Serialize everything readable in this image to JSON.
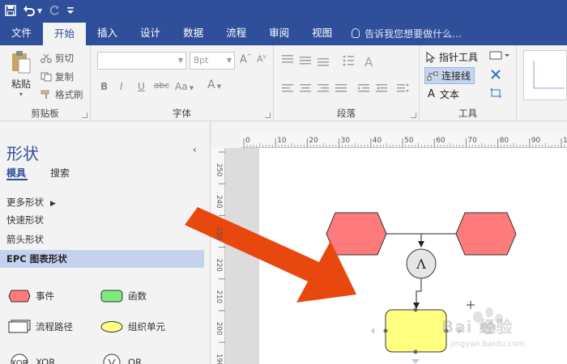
{
  "quick_access": {
    "save_icon": "save-icon",
    "undo_icon": "undo-icon",
    "redo_icon": "redo-icon",
    "customize_icon": "customize-icon"
  },
  "tabs": [
    {
      "label": "文件"
    },
    {
      "label": "开始"
    },
    {
      "label": "插入"
    },
    {
      "label": "设计"
    },
    {
      "label": "数据"
    },
    {
      "label": "流程"
    },
    {
      "label": "审阅"
    },
    {
      "label": "视图"
    }
  ],
  "tell_me": {
    "placeholder": "告诉我您想要做什么..."
  },
  "ribbon": {
    "clipboard": {
      "paste": "粘贴",
      "cut": "剪切",
      "copy": "复制",
      "format_painter": "格式刷",
      "label": "剪贴板"
    },
    "font": {
      "font_name": "",
      "font_size": "8pt",
      "bold": "B",
      "italic": "I",
      "underline": "U",
      "strike": "abc",
      "case": "Aa",
      "color": "A",
      "label": "字体"
    },
    "paragraph": {
      "label": "段落"
    },
    "tools": {
      "pointer": "指针工具",
      "connector": "连接线",
      "text": "文本",
      "text_glyph": "A",
      "label": "工具"
    }
  },
  "shapes_panel": {
    "title": "形状",
    "collapse": "‹",
    "subtabs": [
      "模具",
      "搜索"
    ],
    "stencils": [
      "更多形状",
      "快速形状",
      "箭头形状",
      "EPC 图表形状"
    ],
    "shapes": [
      {
        "label": "事件",
        "color": "#ff7b7b"
      },
      {
        "label": "函数",
        "color": "#7dea7d"
      },
      {
        "label": "流程路径",
        "color": "#ffffff"
      },
      {
        "label": "组织单元",
        "color": "#ffff80"
      },
      {
        "label": "XOR"
      },
      {
        "label": "OR"
      }
    ]
  },
  "ruler_top": [
    "0",
    "10",
    "20",
    "30",
    "40",
    "50",
    "60",
    "70",
    "80",
    "90",
    "100"
  ],
  "ruler_left": [
    "250",
    "240",
    "230",
    "220",
    "210",
    "200",
    "190"
  ],
  "diagram": {
    "event_color": "#ff7b7b",
    "org_color": "#ffff80",
    "connector_symbol": "Λ",
    "arrow_color": "#e8470d"
  },
  "watermark": {
    "brand": "Bai 经验",
    "url": "jingyan.baidu.com"
  }
}
